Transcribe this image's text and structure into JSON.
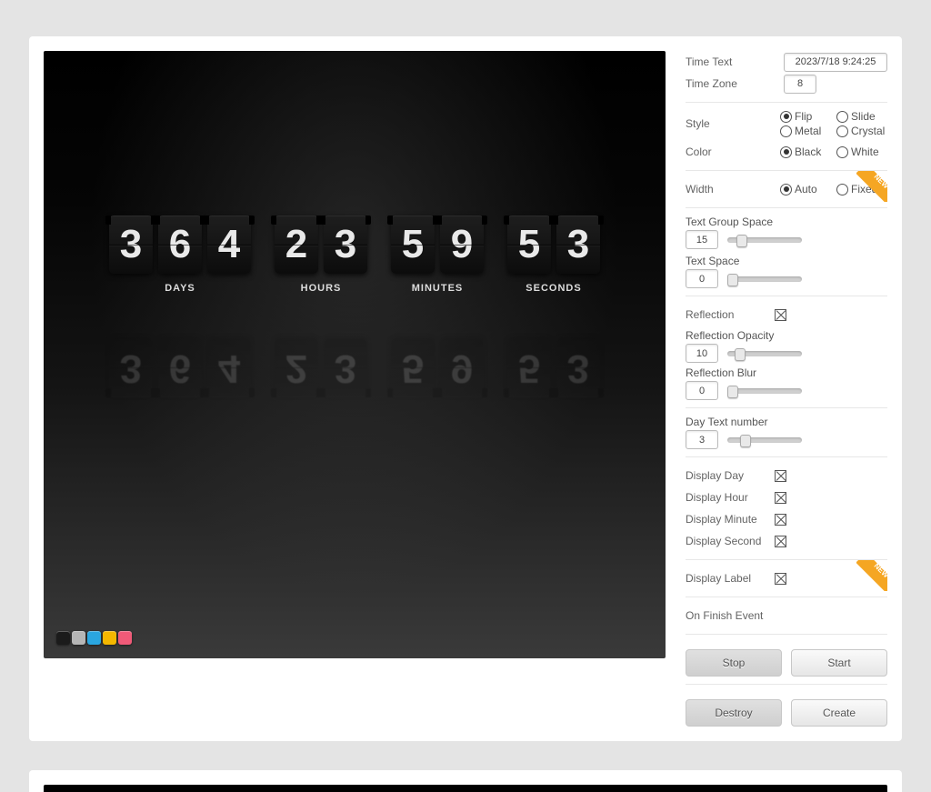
{
  "countdown": {
    "groups": [
      {
        "digits": [
          "3",
          "6",
          "4"
        ],
        "label": "DAYS"
      },
      {
        "digits": [
          "2",
          "3"
        ],
        "label": "HOURS"
      },
      {
        "digits": [
          "5",
          "9"
        ],
        "label": "MINUTES"
      },
      {
        "digits": [
          "5",
          "3"
        ],
        "label": "SECONDS"
      }
    ]
  },
  "swatches": [
    "#1b1b1b",
    "#b6b6b6",
    "#2aa6e0",
    "#f4b700",
    "#f05a78"
  ],
  "settings": {
    "time_text_label": "Time Text",
    "time_text_value": "2023/7/18 9:24:25",
    "time_zone_label": "Time Zone",
    "time_zone_value": "8",
    "style_label": "Style",
    "style_options": [
      "Flip",
      "Slide",
      "Metal",
      "Crystal"
    ],
    "style_selected": "Flip",
    "color_label": "Color",
    "color_options": [
      "Black",
      "White"
    ],
    "color_selected": "Black",
    "width_label": "Width",
    "width_options": [
      "Auto",
      "Fixed"
    ],
    "width_selected": "Auto",
    "text_group_space_label": "Text Group Space",
    "text_group_space_value": "15",
    "text_space_label": "Text Space",
    "text_space_value": "0",
    "reflection_label": "Reflection",
    "reflection_checked": true,
    "reflection_opacity_label": "Reflection Opacity",
    "reflection_opacity_value": "10",
    "reflection_blur_label": "Reflection Blur",
    "reflection_blur_value": "0",
    "day_text_number_label": "Day Text number",
    "day_text_number_value": "3",
    "display_day_label": "Display Day",
    "display_day_checked": true,
    "display_hour_label": "Display Hour",
    "display_hour_checked": true,
    "display_minute_label": "Display Minute",
    "display_minute_checked": true,
    "display_second_label": "Display Second",
    "display_second_checked": true,
    "display_label_label": "Display Label",
    "display_label_checked": true,
    "on_finish_event_label": "On Finish Event",
    "buttons": {
      "stop": "Stop",
      "start": "Start",
      "destroy": "Destroy",
      "create": "Create"
    }
  }
}
